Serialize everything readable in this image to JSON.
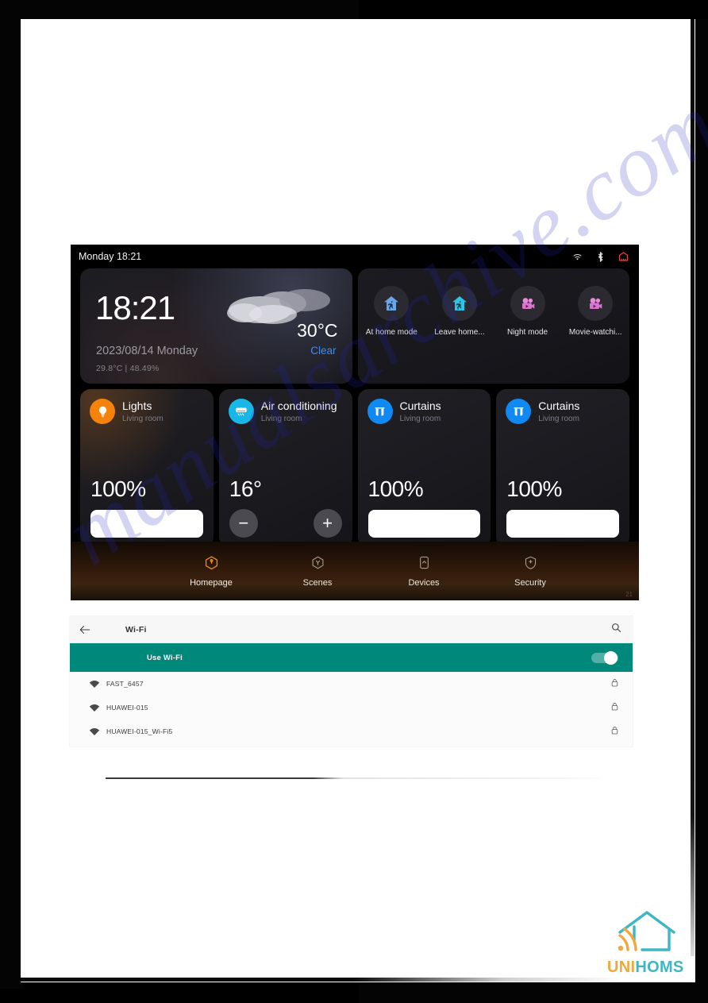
{
  "watermark": {
    "text": "manualsarchive.com"
  },
  "tablet": {
    "status_bar": {
      "clock_date": "Monday 18:21",
      "icons": [
        "wifi-icon",
        "bluetooth-icon",
        "ethernet-icon"
      ]
    },
    "weather": {
      "time": "18:21",
      "date": "2023/08/14 Monday",
      "sub": "29.8°C | 48.49%",
      "temperature": "30°C",
      "condition": "Clear",
      "condition_color": "#3c8ef0"
    },
    "scenes": [
      {
        "label": "At home mode",
        "icon": "house-person-icon",
        "color": "#6aa6e8"
      },
      {
        "label": "Leave home...",
        "icon": "house-person-icon",
        "color": "#2fc3e8"
      },
      {
        "label": "Night mode",
        "icon": "movie-camera-icon",
        "color": "#e48ad8"
      },
      {
        "label": "Movie-watchi...",
        "icon": "movie-camera-icon",
        "color": "#e48ad8"
      }
    ],
    "devices": [
      {
        "title": "Lights",
        "room": "Living room",
        "value": "100%",
        "icon": "lightbulb-icon",
        "icon_color": "#f5820b",
        "control": "slider"
      },
      {
        "title": "Air conditioning",
        "room": "Living room",
        "value": "16°",
        "icon": "air-conditioner-icon",
        "icon_color": "#19b7e8",
        "control": "stepper",
        "minus": "−",
        "plus": "+"
      },
      {
        "title": "Curtains",
        "room": "Living room",
        "value": "100%",
        "icon": "curtains-icon",
        "icon_color": "#1189f2",
        "control": "slider"
      },
      {
        "title": "Curtains",
        "room": "Living room",
        "value": "100%",
        "icon": "curtains-icon",
        "icon_color": "#1189f2",
        "control": "slider"
      }
    ],
    "nav": [
      {
        "label": "Homepage",
        "icon": "home-icon",
        "active": true
      },
      {
        "label": "Scenes",
        "icon": "scenes-icon",
        "active": false
      },
      {
        "label": "Devices",
        "icon": "devices-icon",
        "active": false
      },
      {
        "label": "Security",
        "icon": "shield-icon",
        "active": false
      }
    ],
    "page_number": "21"
  },
  "wifi": {
    "title": "Wi-Fi",
    "back_icon": "arrow-left-icon",
    "search_icon": "search-icon",
    "use_wifi_label": "Use Wi-Fi",
    "use_wifi_enabled": true,
    "accent_color": "#00897b",
    "networks": [
      {
        "ssid": "FAST_6457",
        "signal_icon": "wifi-signal-icon",
        "lock_icon": "lock-icon"
      },
      {
        "ssid": "HUAWEI-015",
        "signal_icon": "wifi-signal-icon",
        "lock_icon": "lock-icon"
      },
      {
        "ssid": "HUAWEI-015_Wi-Fi5",
        "signal_icon": "wifi-signal-icon",
        "lock_icon": "lock-icon"
      }
    ]
  },
  "logo": {
    "first": "UNI",
    "second": "HOMS",
    "first_color": "#f0a83c",
    "second_color": "#3fb6c4",
    "mark": "house-wifi-icon"
  }
}
